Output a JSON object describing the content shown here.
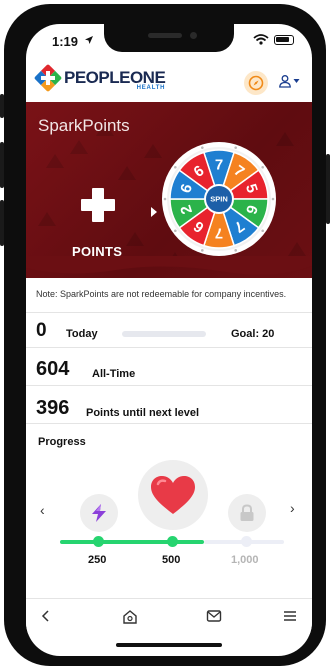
{
  "status_bar": {
    "time": "1:19"
  },
  "header": {
    "logo_main": "PEOPLEONE",
    "logo_sub": "HEALTH",
    "compass_icon": "compass-icon",
    "user_icon": "user-icon",
    "brand_colors": {
      "navy": "#1a2a52",
      "blue": "#1a72c8",
      "green": "#2bb34a",
      "red": "#e0282e",
      "orange": "#f39a1e"
    }
  },
  "banner": {
    "title": "SparkPoints",
    "points_label": "POINTS",
    "background": "#6b0f13",
    "wheel": {
      "center_label": "SPIN",
      "segments": [
        {
          "label": "7",
          "color": "#1f7fd1"
        },
        {
          "label": "7",
          "color": "#f58220"
        },
        {
          "label": "5",
          "color": "#e8232d"
        },
        {
          "label": "6",
          "color": "#2bb34a"
        },
        {
          "label": "7",
          "color": "#1f7fd1"
        },
        {
          "label": "7",
          "color": "#f58220"
        },
        {
          "label": "6",
          "color": "#e8232d"
        },
        {
          "label": "2",
          "color": "#2bb34a"
        },
        {
          "label": "6",
          "color": "#1f7fd1"
        },
        {
          "label": "6",
          "color": "#e8232d"
        }
      ]
    }
  },
  "note": "Note: SparkPoints are not redeemable for company incentives.",
  "today": {
    "value": "0",
    "label": "Today",
    "goal_text": "Goal: 20",
    "progress_fraction": 0
  },
  "all_time": {
    "value": "604",
    "label": "All-Time"
  },
  "next_level": {
    "value": "396",
    "label": "Points until next level"
  },
  "progress": {
    "title": "Progress",
    "levels": [
      {
        "label": "250",
        "icon": "lightning-icon",
        "state": "done"
      },
      {
        "label": "500",
        "icon": "heart-icon",
        "state": "current"
      },
      {
        "label": "1,000",
        "icon": "lock-icon",
        "state": "locked"
      }
    ],
    "accent": "#26d46f"
  },
  "bottom_nav": [
    "back-icon",
    "home-icon",
    "mail-icon",
    "menu-icon"
  ]
}
